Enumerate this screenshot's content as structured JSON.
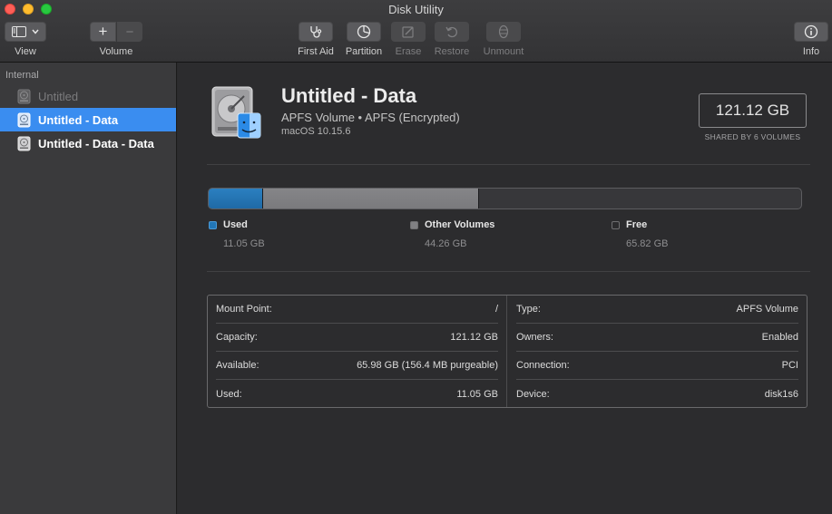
{
  "window": {
    "title": "Disk Utility"
  },
  "toolbar": {
    "view_label": "View",
    "volume_label": "Volume",
    "first_aid_label": "First Aid",
    "partition_label": "Partition",
    "erase_label": "Erase",
    "restore_label": "Restore",
    "unmount_label": "Unmount",
    "info_label": "Info",
    "add_glyph": "+",
    "remove_glyph": "−"
  },
  "sidebar": {
    "heading": "Internal",
    "items": [
      {
        "label": "Untitled",
        "state": "dimmed"
      },
      {
        "label": "Untitled - Data",
        "state": "selected"
      },
      {
        "label": "Untitled - Data - Data",
        "state": "normal"
      }
    ]
  },
  "volume": {
    "name": "Untitled - Data",
    "subtitle": "APFS Volume • APFS (Encrypted)",
    "os": "macOS 10.15.6",
    "size": "121.12 GB",
    "shared_note": "SHARED BY 6 VOLUMES"
  },
  "usage": {
    "total_gb": 121.12,
    "used": {
      "label": "Used",
      "value": "11.05 GB",
      "gb": 11.05,
      "color": "#2277b8"
    },
    "other": {
      "label": "Other Volumes",
      "value": "44.26 GB",
      "gb": 44.26,
      "color": "#808083"
    },
    "free": {
      "label": "Free",
      "value": "65.82 GB",
      "gb": 65.82,
      "color": "#37373a"
    }
  },
  "details": {
    "left": [
      {
        "key": "Mount Point:",
        "value": "/"
      },
      {
        "key": "Capacity:",
        "value": "121.12 GB"
      },
      {
        "key": "Available:",
        "value": "65.98 GB (156.4 MB purgeable)"
      },
      {
        "key": "Used:",
        "value": "11.05 GB"
      }
    ],
    "right": [
      {
        "key": "Type:",
        "value": "APFS Volume"
      },
      {
        "key": "Owners:",
        "value": "Enabled"
      },
      {
        "key": "Connection:",
        "value": "PCI"
      },
      {
        "key": "Device:",
        "value": "disk1s6"
      }
    ]
  },
  "colors": {
    "accent": "#3a8df0",
    "sidebar_bg": "#3a3a3c",
    "main_bg": "#2c2c2e"
  }
}
